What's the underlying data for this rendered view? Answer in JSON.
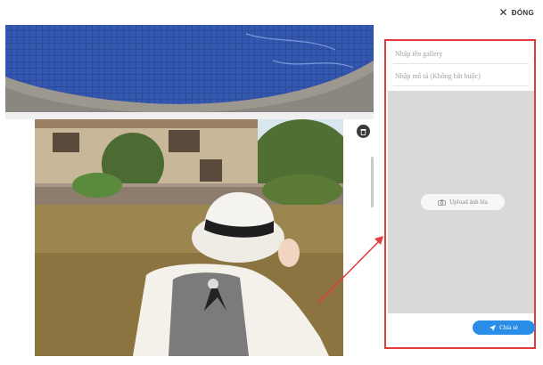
{
  "header": {
    "close_label": "ĐÓNG"
  },
  "form": {
    "title_placeholder": "Nhập tên gallery",
    "description_placeholder": "Nhập mô tả (Không bắt buộc)",
    "upload_cover_label": "Upload ảnh bìa",
    "share_label": "Chia sẻ"
  },
  "icons": {
    "close": "close-icon",
    "trash": "trash-icon",
    "camera": "camera-icon",
    "send": "send-icon"
  },
  "colors": {
    "highlight": "#e33b3b",
    "share_button": "#2a8ee8",
    "cover_placeholder": "#d9d9d9"
  }
}
